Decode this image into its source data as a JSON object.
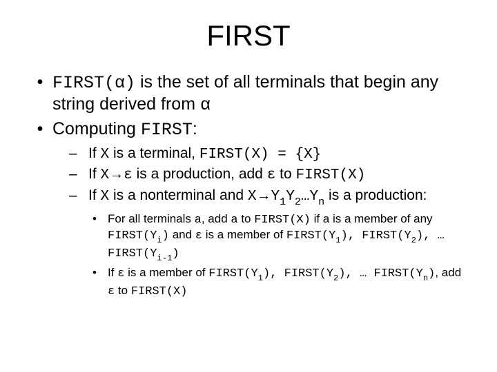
{
  "title": "FIRST",
  "bullets": {
    "b1_pre": "FIRST(α)",
    "b1_mid": " is the set of all terminals that begin any string derived from ",
    "b1_post": "α",
    "b2_pre": "Computing ",
    "b2_mono": "FIRST",
    "b2_post": ":"
  },
  "subs": {
    "s1_a": "If ",
    "s1_b": "X",
    "s1_c": " is a terminal, ",
    "s1_d": "FIRST(X) = {X}",
    "s2_a": "If ",
    "s2_b": "X",
    "s2_c": "→",
    "s2_d": "ε",
    "s2_e": " is a production, add ",
    "s2_f": "ε",
    "s2_g": " to ",
    "s2_h": "FIRST(X)",
    "s3_a": "If ",
    "s3_b": "X",
    "s3_c": " is a nonterminal and ",
    "s3_d": "X",
    "s3_e": "→",
    "s3_f": "Y",
    "s3_f1": "1",
    "s3_g": "Y",
    "s3_g1": "2",
    "s3_h": "…Y",
    "s3_h1": "n",
    "s3_i": " is a production:"
  },
  "subsubs": {
    "t1_a": "For all terminals ",
    "t1_b": "a",
    "t1_c": ", add ",
    "t1_d": "a",
    "t1_e": " to ",
    "t1_f": "FIRST(X)",
    "t1_g": " if a is a member of any ",
    "t1_h": "FIRST(Y",
    "t1_h1": "i",
    "t1_i": ")",
    "t1_j": " and ",
    "t1_k": "ε",
    "t1_l": " is a member of ",
    "t1_m": "FIRST(Y",
    "t1_m1": "1",
    "t1_n": "), FIRST(Y",
    "t1_n1": "2",
    "t1_o": "), … FIRST(Y",
    "t1_o1": "i-1",
    "t1_p": ")",
    "t2_a": "If ",
    "t2_b": "ε",
    "t2_c": " is a member of ",
    "t2_d": "FIRST(Y",
    "t2_d1": "1",
    "t2_e": "), FIRST(Y",
    "t2_e1": "2",
    "t2_f": "), … FIRST(Y",
    "t2_f1": "n",
    "t2_g": ")",
    "t2_h": ", add ",
    "t2_i": "ε",
    "t2_j": " to ",
    "t2_k": "FIRST(X)"
  },
  "markers": {
    "bullet": "•",
    "dash": "–",
    "dot": "•"
  }
}
